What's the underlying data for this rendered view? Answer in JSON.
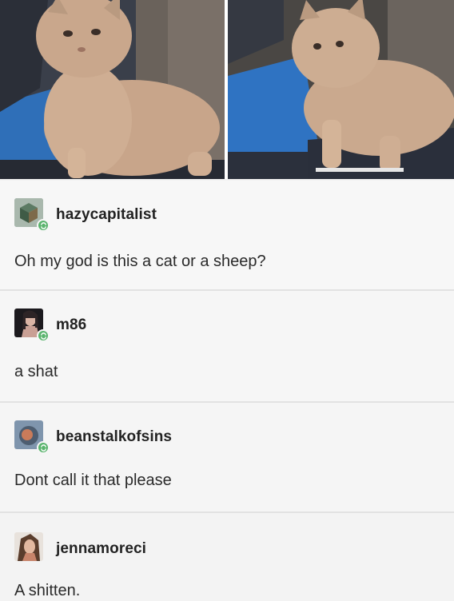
{
  "posts": [
    {
      "username": "hazycapitalist",
      "text": "Oh my god is this a cat or a sheep?"
    },
    {
      "username": "m86",
      "text": "a shat"
    },
    {
      "username": "beanstalkofsins",
      "text": "Dont call it that please"
    },
    {
      "username": "jennamoreci",
      "text": "A shitten."
    }
  ]
}
